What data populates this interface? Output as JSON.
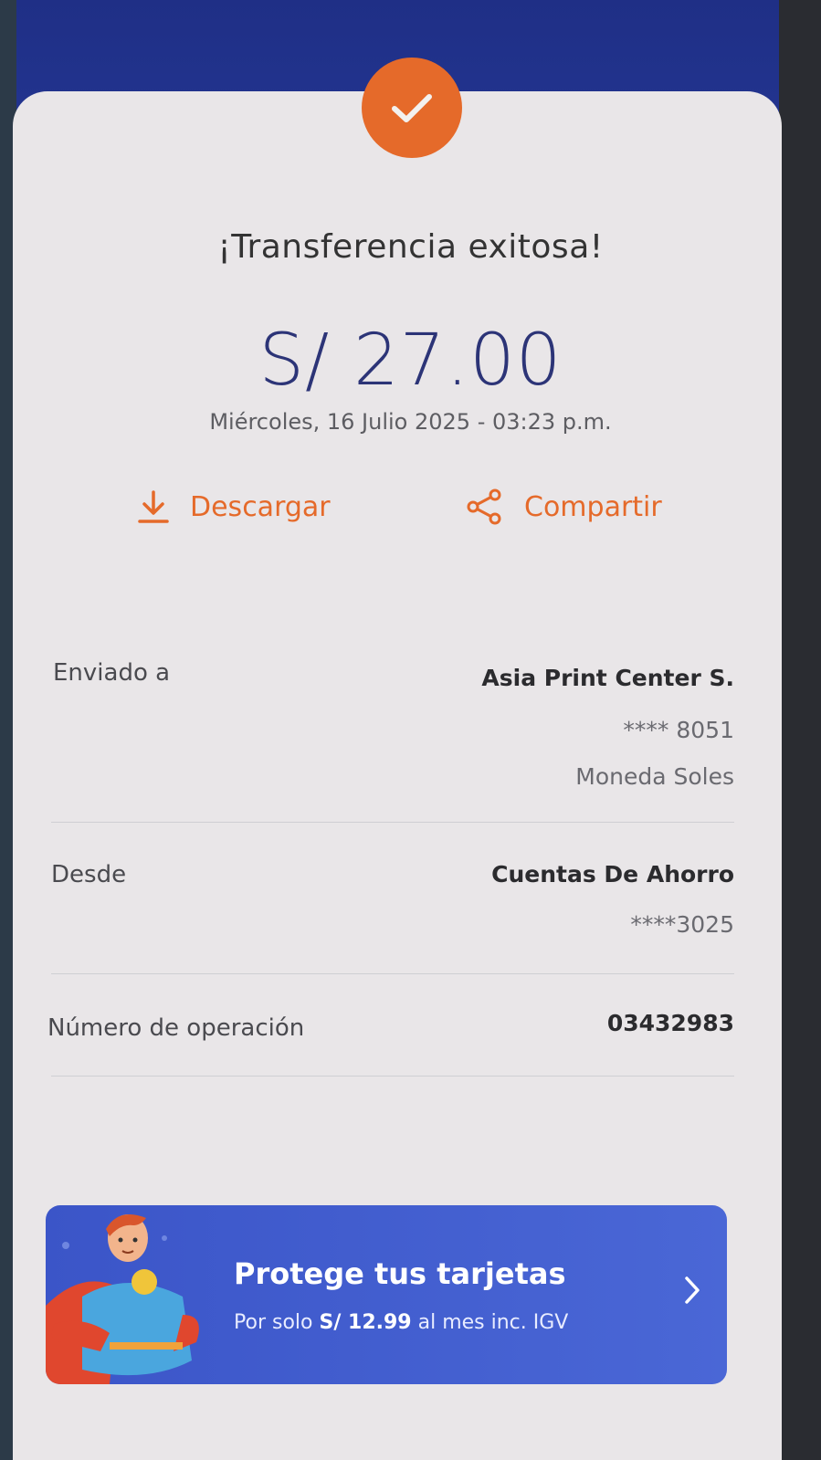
{
  "header": {
    "success_icon": "check-icon",
    "colors": {
      "accent": "#e56a2a",
      "header_blue": "#1f2f86",
      "amount_blue": "#2c3477"
    }
  },
  "receipt": {
    "title": "¡Transferencia exitosa!",
    "amount": "S/ 27.00",
    "datetime": "Miércoles, 16 Julio 2025 - 03:23 p.m."
  },
  "actions": {
    "download_label": "Descargar",
    "download_icon": "download-icon",
    "share_label": "Compartir",
    "share_icon": "share-icon"
  },
  "details": {
    "sent_to": {
      "label": "Enviado a",
      "name": "Asia Print Center S.",
      "account": "**** 8051",
      "currency": "Moneda Soles"
    },
    "from": {
      "label": "Desde",
      "account_type": "Cuentas De Ahorro",
      "account": "****3025"
    },
    "operation": {
      "label": "Número de operación",
      "number": "03432983"
    }
  },
  "promo": {
    "title": "Protege tus tarjetas",
    "sub_prefix": "Por solo ",
    "sub_price": "S/ 12.99",
    "sub_suffix": " al mes inc. IGV",
    "mascot": "superhero-mascot",
    "chevron_icon": "chevron-right-icon",
    "background": "#3b55c8"
  }
}
